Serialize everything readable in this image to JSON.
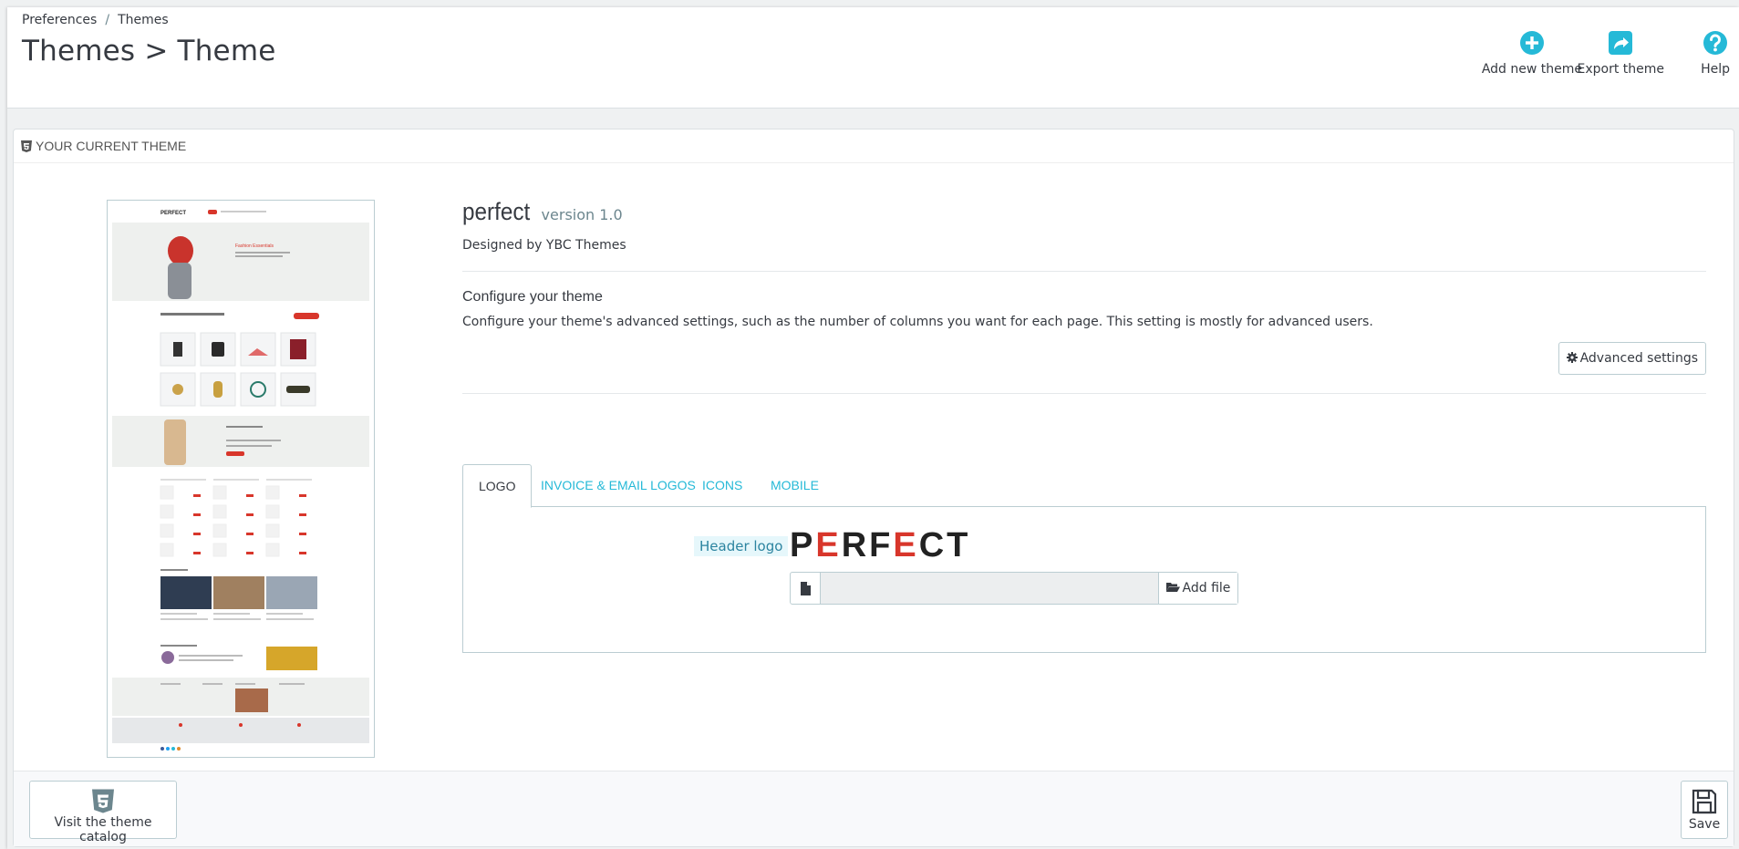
{
  "breadcrumb": {
    "first": "Preferences",
    "separator": "/",
    "second": "Themes"
  },
  "page": {
    "title": "Themes > Theme"
  },
  "toolbar": {
    "add_label": "Add new theme",
    "export_label": "Export theme",
    "help_label": "Help"
  },
  "panel": {
    "heading": "Your current theme"
  },
  "theme": {
    "name": "perfect",
    "version": "version 1.0",
    "designer": "Designed by YBC Themes"
  },
  "configure": {
    "title": "Configure your theme",
    "description": "Configure your theme's advanced settings, such as the number of columns you want for each page. This setting is mostly for advanced users.",
    "advanced_button": "Advanced settings"
  },
  "tabs": [
    "Logo",
    "Invoice & Email Logos",
    "Icons",
    "Mobile"
  ],
  "active_tab": "Logo",
  "logo": {
    "label": "Header logo",
    "logo_text": {
      "p": "P",
      "e1": "E",
      "rf": "RF",
      "e2": "E",
      "ct": "CT"
    },
    "file_value": "",
    "add_file_label": "Add file"
  },
  "footer": {
    "catalog_label": "Visit the theme catalog",
    "save_label": "Save"
  },
  "colors": {
    "accent": "#25b9d7",
    "text": "#363a41",
    "logo_red": "#d8362b"
  },
  "icons": {
    "add": "plus-circle-icon",
    "export": "share-icon",
    "help": "question-circle-icon",
    "heading": "html5-icon",
    "advanced": "gear-icon",
    "file": "file-icon",
    "add_file": "folder-open-icon",
    "catalog": "html5-icon",
    "save": "floppy-disk-icon"
  }
}
